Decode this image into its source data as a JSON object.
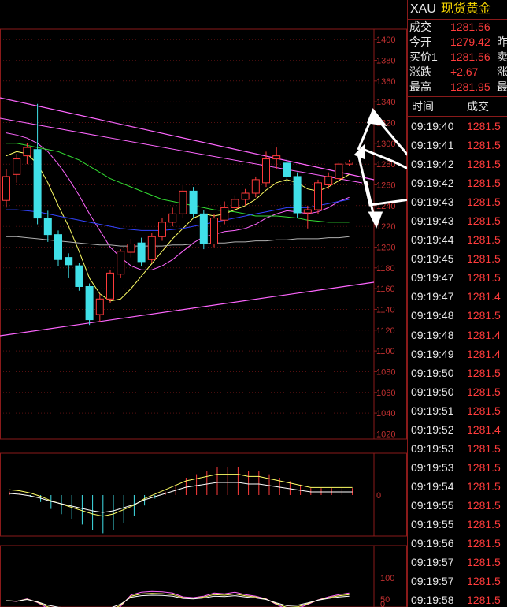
{
  "header": {
    "symbol": "XAU",
    "name": "现货黄金"
  },
  "quote": [
    {
      "label": "成交",
      "value": "1281.56",
      "right": ""
    },
    {
      "label": "今开",
      "value": "1279.42",
      "right": "昨"
    },
    {
      "label": "买价1",
      "value": "1281.56",
      "right": "卖"
    },
    {
      "label": "涨跌",
      "value": "+2.67",
      "right": "涨"
    },
    {
      "label": "最高",
      "value": "1281.95",
      "right": "最"
    }
  ],
  "ticks_header": {
    "time": "时间",
    "price": "成交"
  },
  "ticks": [
    {
      "time": "09:19:40",
      "price": "1281.5",
      "dir": "up"
    },
    {
      "time": "09:19:41",
      "price": "1281.5",
      "dir": "up"
    },
    {
      "time": "09:19:42",
      "price": "1281.5",
      "dir": "up"
    },
    {
      "time": "09:19:42",
      "price": "1281.5",
      "dir": "up"
    },
    {
      "time": "09:19:43",
      "price": "1281.5",
      "dir": "up"
    },
    {
      "time": "09:19:43",
      "price": "1281.5",
      "dir": "up"
    },
    {
      "time": "09:19:44",
      "price": "1281.5",
      "dir": "up"
    },
    {
      "time": "09:19:45",
      "price": "1281.5",
      "dir": "up"
    },
    {
      "time": "09:19:47",
      "price": "1281.5",
      "dir": "up"
    },
    {
      "time": "09:19:47",
      "price": "1281.4",
      "dir": "up"
    },
    {
      "time": "09:19:48",
      "price": "1281.5",
      "dir": "up"
    },
    {
      "time": "09:19:48",
      "price": "1281.4",
      "dir": "up"
    },
    {
      "time": "09:19:49",
      "price": "1281.4",
      "dir": "up"
    },
    {
      "time": "09:19:50",
      "price": "1281.5",
      "dir": "up"
    },
    {
      "time": "09:19:50",
      "price": "1281.5",
      "dir": "up"
    },
    {
      "time": "09:19:51",
      "price": "1281.5",
      "dir": "up"
    },
    {
      "time": "09:19:52",
      "price": "1281.4",
      "dir": "up"
    },
    {
      "time": "09:19:53",
      "price": "1281.5",
      "dir": "up"
    },
    {
      "time": "09:19:53",
      "price": "1281.5",
      "dir": "up"
    },
    {
      "time": "09:19:54",
      "price": "1281.5",
      "dir": "up"
    },
    {
      "time": "09:19:55",
      "price": "1281.5",
      "dir": "up"
    },
    {
      "time": "09:19:55",
      "price": "1281.5",
      "dir": "up"
    },
    {
      "time": "09:19:56",
      "price": "1281.5",
      "dir": "up"
    },
    {
      "time": "09:19:57",
      "price": "1281.5",
      "dir": "up"
    },
    {
      "time": "09:19:57",
      "price": "1281.5",
      "dir": "up"
    },
    {
      "time": "09:19:58",
      "price": "1281.5",
      "dir": "up"
    }
  ],
  "colors": {
    "up": "#ff3b3b",
    "down": "#40e0e8",
    "grid": "#8a1a1a",
    "axis_text": "#c03030"
  },
  "chart_data": [
    {
      "type": "candlestick",
      "ylim": [
        1020,
        1400
      ],
      "y_ticks": [
        1400,
        1380,
        1360,
        1340,
        1320,
        1300,
        1280,
        1260,
        1240,
        1220,
        1200,
        1180,
        1160,
        1140,
        1120,
        1100,
        1080,
        1060,
        1040,
        1020
      ],
      "candles": [
        {
          "o": 1245,
          "c": 1268,
          "h": 1275,
          "l": 1238
        },
        {
          "o": 1270,
          "c": 1285,
          "h": 1290,
          "l": 1262
        },
        {
          "o": 1288,
          "c": 1296,
          "h": 1300,
          "l": 1280
        },
        {
          "o": 1294,
          "c": 1228,
          "h": 1338,
          "l": 1222
        },
        {
          "o": 1228,
          "c": 1212,
          "h": 1235,
          "l": 1205
        },
        {
          "o": 1212,
          "c": 1188,
          "h": 1216,
          "l": 1182
        },
        {
          "o": 1190,
          "c": 1183,
          "h": 1194,
          "l": 1170
        },
        {
          "o": 1182,
          "c": 1162,
          "h": 1185,
          "l": 1158
        },
        {
          "o": 1162,
          "c": 1130,
          "h": 1165,
          "l": 1125
        },
        {
          "o": 1135,
          "c": 1150,
          "h": 1155,
          "l": 1128
        },
        {
          "o": 1150,
          "c": 1175,
          "h": 1178,
          "l": 1146
        },
        {
          "o": 1174,
          "c": 1196,
          "h": 1198,
          "l": 1170
        },
        {
          "o": 1195,
          "c": 1203,
          "h": 1208,
          "l": 1190
        },
        {
          "o": 1204,
          "c": 1186,
          "h": 1209,
          "l": 1182
        },
        {
          "o": 1188,
          "c": 1210,
          "h": 1214,
          "l": 1185
        },
        {
          "o": 1210,
          "c": 1224,
          "h": 1228,
          "l": 1206
        },
        {
          "o": 1224,
          "c": 1232,
          "h": 1238,
          "l": 1220
        },
        {
          "o": 1232,
          "c": 1254,
          "h": 1260,
          "l": 1228
        },
        {
          "o": 1254,
          "c": 1232,
          "h": 1258,
          "l": 1228
        },
        {
          "o": 1232,
          "c": 1203,
          "h": 1236,
          "l": 1198
        },
        {
          "o": 1203,
          "c": 1228,
          "h": 1232,
          "l": 1200
        },
        {
          "o": 1226,
          "c": 1238,
          "h": 1244,
          "l": 1222
        },
        {
          "o": 1238,
          "c": 1246,
          "h": 1250,
          "l": 1234
        },
        {
          "o": 1246,
          "c": 1252,
          "h": 1256,
          "l": 1240
        },
        {
          "o": 1252,
          "c": 1265,
          "h": 1268,
          "l": 1248
        },
        {
          "o": 1262,
          "c": 1285,
          "h": 1292,
          "l": 1258
        },
        {
          "o": 1285,
          "c": 1288,
          "h": 1296,
          "l": 1275
        },
        {
          "o": 1281,
          "c": 1268,
          "h": 1285,
          "l": 1262
        },
        {
          "o": 1268,
          "c": 1233,
          "h": 1272,
          "l": 1228
        },
        {
          "o": 1233,
          "c": 1236,
          "h": 1240,
          "l": 1218
        },
        {
          "o": 1236,
          "c": 1262,
          "h": 1265,
          "l": 1232
        },
        {
          "o": 1260,
          "c": 1268,
          "h": 1272,
          "l": 1256
        },
        {
          "o": 1266,
          "c": 1280,
          "h": 1282,
          "l": 1262
        },
        {
          "o": 1280,
          "c": 1282,
          "h": 1284,
          "l": 1278
        }
      ],
      "moving_averages": [
        {
          "color": "#ffff66",
          "values": [
            1288,
            1292,
            1290,
            1280,
            1262,
            1240,
            1220,
            1196,
            1170,
            1155,
            1148,
            1150,
            1160,
            1172,
            1184,
            1196,
            1208,
            1218,
            1228,
            1232,
            1230,
            1232,
            1236,
            1240,
            1246,
            1255,
            1262,
            1265,
            1262,
            1256,
            1254,
            1258,
            1264,
            1270
          ]
        },
        {
          "color": "#ff66ff",
          "values": [
            1310,
            1308,
            1305,
            1300,
            1292,
            1280,
            1266,
            1250,
            1232,
            1216,
            1200,
            1190,
            1182,
            1178,
            1178,
            1182,
            1188,
            1196,
            1204,
            1210,
            1212,
            1215,
            1216,
            1218,
            1222,
            1228,
            1232,
            1235,
            1234,
            1232,
            1234,
            1238,
            1244,
            1248
          ]
        },
        {
          "color": "#33dd33",
          "values": [
            1300,
            1300,
            1298,
            1296,
            1294,
            1292,
            1288,
            1284,
            1278,
            1272,
            1266,
            1262,
            1258,
            1254,
            1250,
            1246,
            1244,
            1242,
            1240,
            1238,
            1236,
            1235,
            1234,
            1232,
            1230,
            1230,
            1230,
            1229,
            1228,
            1226,
            1225,
            1224,
            1224,
            1224
          ]
        },
        {
          "color": "#3344ff",
          "values": [
            1236,
            1236,
            1235,
            1234,
            1232,
            1230,
            1228,
            1226,
            1224,
            1222,
            1220,
            1218,
            1217,
            1216,
            1216,
            1216,
            1217,
            1218,
            1220,
            1222,
            1224,
            1226,
            1228,
            1230,
            1232,
            1234,
            1236,
            1238,
            1238,
            1238,
            1240,
            1242,
            1244,
            1246
          ]
        },
        {
          "color": "#b0b0b0",
          "values": [
            1210,
            1210,
            1209,
            1208,
            1207,
            1206,
            1205,
            1204,
            1203,
            1202,
            1202,
            1201,
            1201,
            1201,
            1201,
            1201,
            1202,
            1202,
            1203,
            1203,
            1204,
            1204,
            1205,
            1205,
            1206,
            1206,
            1207,
            1207,
            1208,
            1208,
            1208,
            1209,
            1209,
            1210
          ]
        }
      ]
    },
    {
      "type": "bar",
      "y_ticks": [
        0
      ],
      "values": [
        2,
        1,
        -1,
        -4,
        -8,
        -11,
        -14,
        -17,
        -20,
        -22,
        -20,
        -16,
        -12,
        -6,
        -2,
        2,
        6,
        10,
        12,
        14,
        16,
        16,
        16,
        14,
        14,
        12,
        10,
        8,
        6,
        4,
        4,
        4,
        4,
        4
      ]
    },
    {
      "type": "line",
      "ylim": [
        0,
        100
      ],
      "y_ticks": [
        100,
        50,
        0
      ]
    }
  ]
}
